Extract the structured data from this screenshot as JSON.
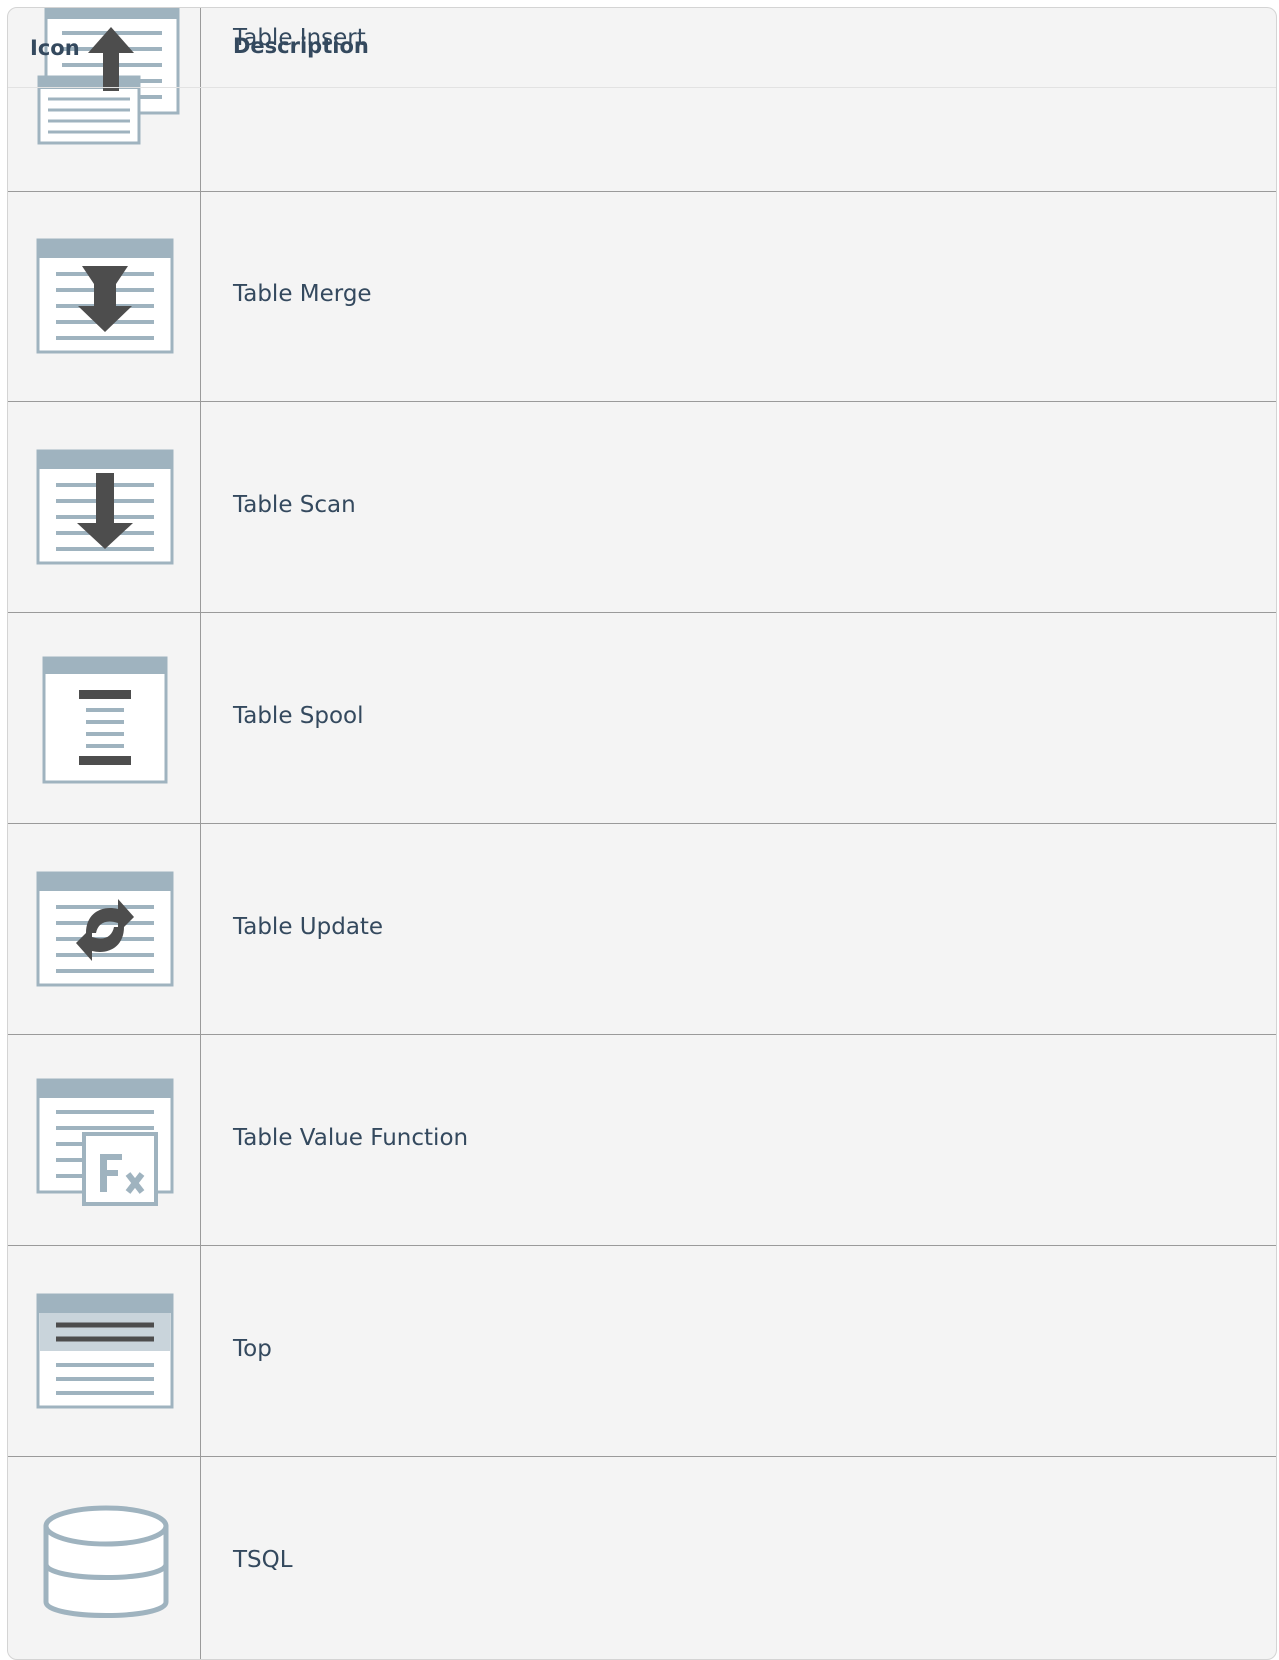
{
  "table": {
    "headers": {
      "icon": "Icon",
      "description": "Description"
    },
    "rows": [
      {
        "icon": "table-insert-icon",
        "description": "Table Insert"
      },
      {
        "icon": "table-merge-icon",
        "description": "Table Merge"
      },
      {
        "icon": "table-scan-icon",
        "description": "Table Scan"
      },
      {
        "icon": "table-spool-icon",
        "description": "Table Spool"
      },
      {
        "icon": "table-update-icon",
        "description": "Table Update"
      },
      {
        "icon": "table-value-function-icon",
        "description": "Table Value Function"
      },
      {
        "icon": "top-icon",
        "description": "Top"
      },
      {
        "icon": "tsql-icon",
        "description": "TSQL"
      }
    ]
  },
  "colors": {
    "icon_frame": "#9fb3bf",
    "icon_fill": "#ffffff",
    "icon_dark": "#4d4d4d",
    "text": "#34495e",
    "background": "#f4f4f4"
  }
}
